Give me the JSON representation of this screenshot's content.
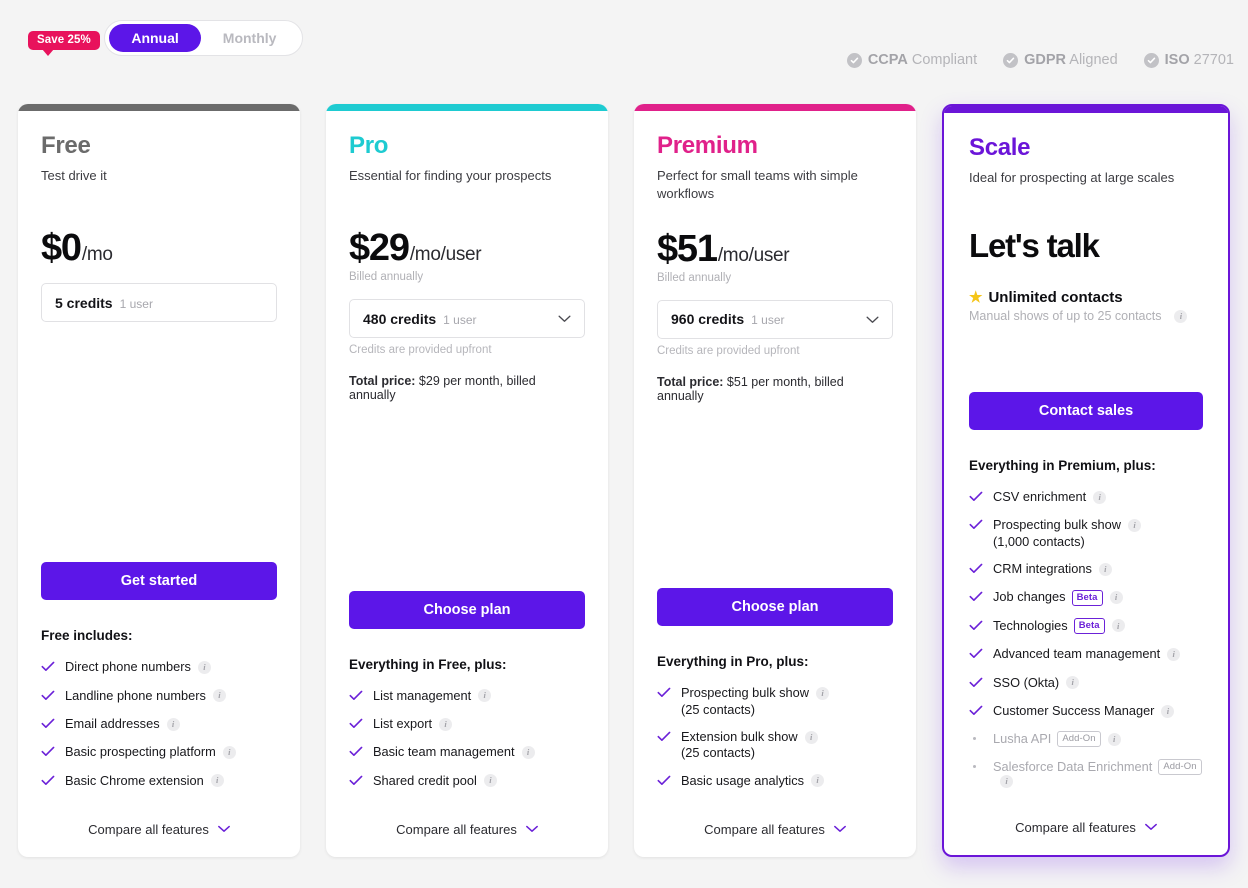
{
  "billing_toggle": {
    "save_badge": "Save 25%",
    "options": [
      {
        "label": "Annual",
        "selected": true
      },
      {
        "label": "Monthly",
        "selected": false
      }
    ]
  },
  "compliance": [
    {
      "icon": "check-circle-icon",
      "strong": "CCPA",
      "rest": "Compliant"
    },
    {
      "icon": "check-circle-icon",
      "strong": "GDPR",
      "rest": "Aligned"
    },
    {
      "icon": "check-circle-icon",
      "strong": "ISO",
      "rest": "27701"
    }
  ],
  "colors": {
    "page_bg": "#f4f4f4",
    "cta": "#5c16e8",
    "free_accent": "#6b6b6b",
    "pro_accent": "#1ecbd1",
    "premium_accent": "#e0218a",
    "scale_accent": "#6b15d8",
    "badge_pink": "#e8125c",
    "tick": "#6b21d8",
    "star": "#f5c518"
  },
  "compare_link": {
    "label": "Compare all features",
    "icon": "chevron-down-icon"
  },
  "plans": [
    {
      "id": "free",
      "name": "Free",
      "name_color": "#6b6b6b",
      "accent": "#6b6b6b",
      "description": "Test drive it",
      "price_amount": "$0",
      "price_unit": "/mo",
      "billed_note": "",
      "credit_value": "5 credits",
      "credit_users": "1 user",
      "credit_is_select": false,
      "upfront_note": "",
      "total_price": "",
      "cta_label": "Get started",
      "features_title": "Free includes:",
      "features": [
        {
          "label": "Direct phone numbers",
          "marker": "check",
          "info": true
        },
        {
          "label": "Landline phone numbers",
          "marker": "check",
          "info": true
        },
        {
          "label": "Email addresses",
          "marker": "check",
          "info": true
        },
        {
          "label": "Basic prospecting platform",
          "marker": "check",
          "info": true
        },
        {
          "label": "Basic Chrome extension",
          "marker": "check",
          "info": true
        }
      ]
    },
    {
      "id": "pro",
      "name": "Pro",
      "name_color": "#1ecbd1",
      "accent": "#1ecbd1",
      "description": "Essential for finding your prospects",
      "price_amount": "$29",
      "price_unit": "/mo/user",
      "billed_note": "Billed annually",
      "credit_value": "480 credits",
      "credit_users": "1 user",
      "credit_is_select": true,
      "upfront_note": "Credits are provided upfront",
      "total_price_label": "Total price:",
      "total_price": " $29 per month, billed annually",
      "cta_label": "Choose plan",
      "features_title": "Everything in Free, plus:",
      "features": [
        {
          "label": "List management",
          "marker": "check",
          "info": true
        },
        {
          "label": "List export",
          "marker": "check",
          "info": true
        },
        {
          "label": "Basic team management",
          "marker": "check",
          "info": true
        },
        {
          "label": "Shared credit pool",
          "marker": "check",
          "info": true
        }
      ]
    },
    {
      "id": "premium",
      "name": "Premium",
      "name_color": "#e0218a",
      "accent": "#e0218a",
      "description": "Perfect for small teams with simple workflows",
      "price_amount": "$51",
      "price_unit": "/mo/user",
      "billed_note": "Billed annually",
      "credit_value": "960 credits",
      "credit_users": "1 user",
      "credit_is_select": true,
      "upfront_note": "Credits are provided upfront",
      "total_price_label": "Total price:",
      "total_price": " $51 per month, billed annually",
      "cta_label": "Choose plan",
      "features_title": "Everything in Pro, plus:",
      "features": [
        {
          "label": "Prospecting bulk show",
          "second_line": "(25 contacts)",
          "marker": "check",
          "info": true
        },
        {
          "label": "Extension bulk show",
          "second_line": "(25 contacts)",
          "marker": "check",
          "info": true
        },
        {
          "label": "Basic usage analytics",
          "marker": "check",
          "info": true
        }
      ]
    },
    {
      "id": "scale",
      "name": "Scale",
      "name_color": "#6b15d8",
      "accent": "#6b15d8",
      "featured": true,
      "description": "Ideal for prospecting at large scales",
      "lets_talk": "Let's talk",
      "unlimited_label": "Unlimited contacts",
      "unlimited_icon": "star-icon",
      "manual_note": "Manual shows of up to 25 contacts",
      "cta_label": "Contact sales",
      "features_title": "Everything in Premium, plus:",
      "features": [
        {
          "label": "CSV enrichment",
          "marker": "check",
          "info": true
        },
        {
          "label": "Prospecting bulk show",
          "second_line": "(1,000 contacts)",
          "marker": "check",
          "info": true
        },
        {
          "label": "CRM integrations",
          "marker": "check",
          "info": true
        },
        {
          "label": "Job changes",
          "marker": "check",
          "pill": "Beta",
          "pill_type": "beta",
          "info": true
        },
        {
          "label": "Technologies",
          "marker": "check",
          "pill": "Beta",
          "pill_type": "beta",
          "info": true
        },
        {
          "label": "Advanced team management",
          "marker": "check",
          "info": true
        },
        {
          "label": "SSO (Okta)",
          "marker": "check",
          "info": true
        },
        {
          "label": "Customer Success Manager",
          "marker": "check",
          "info": true
        },
        {
          "label": "Lusha API",
          "marker": "dot",
          "pill": "Add-On",
          "pill_type": "addon",
          "info": true,
          "muted": true
        },
        {
          "label": "Salesforce Data Enrichment",
          "marker": "dot",
          "pill": "Add-On",
          "pill_type": "addon",
          "info": true,
          "muted": true
        }
      ]
    }
  ]
}
